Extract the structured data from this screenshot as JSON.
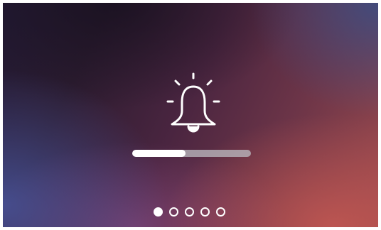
{
  "screen": {
    "icon": "bell-icon",
    "colors": {
      "foreground": "#ffffff",
      "track": "#bebec3",
      "background_top_left": "#241b36",
      "background_bottom_right": "#c45852"
    }
  },
  "progress": {
    "fraction": 0.45
  },
  "pager": {
    "total": 5,
    "active_index": 0
  }
}
